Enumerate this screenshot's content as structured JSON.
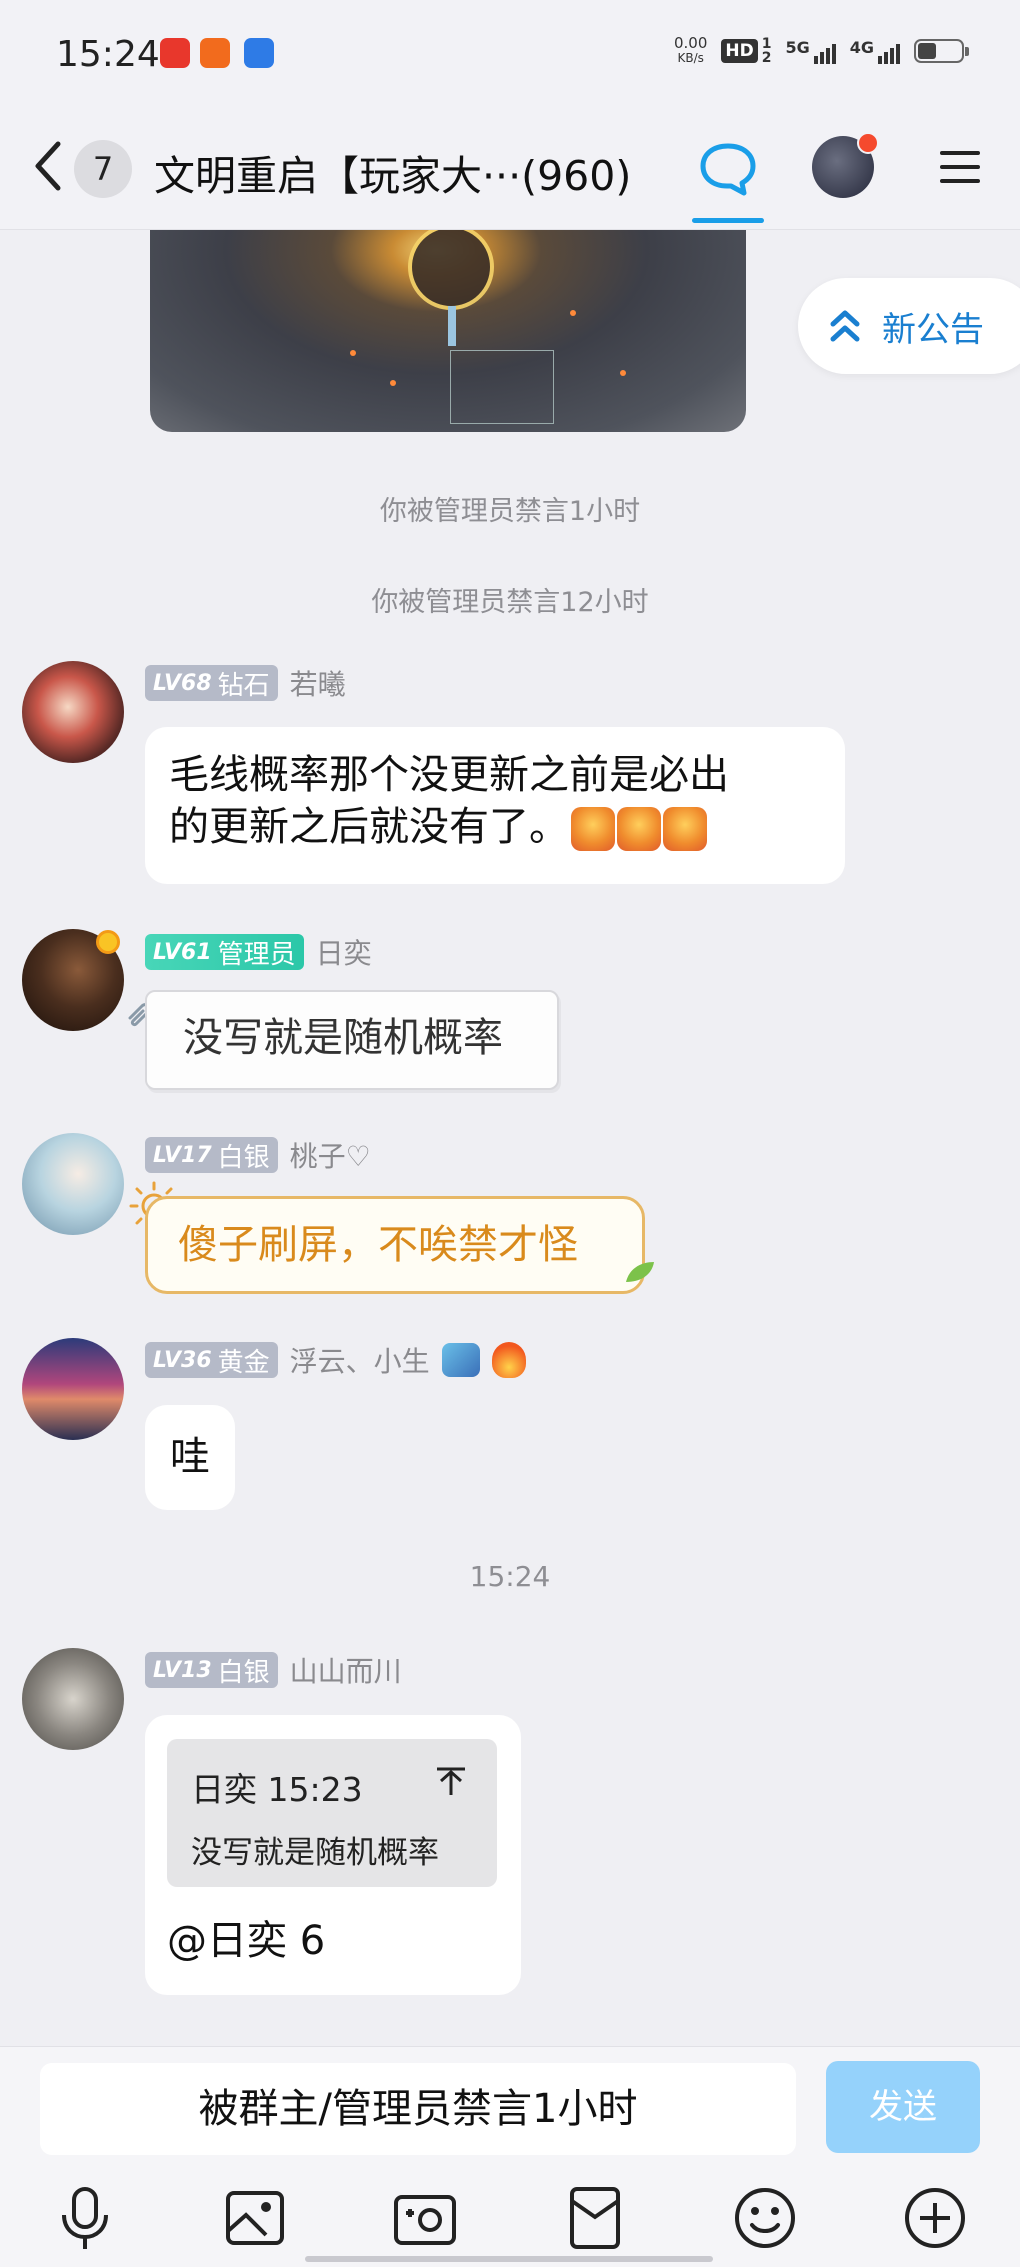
{
  "status_bar": {
    "time": "15:24",
    "net_speed_value": "0.00",
    "net_speed_unit": "KB/s",
    "hd": "HD",
    "sim1": "1",
    "sim2": "2",
    "signal1_label": "5G",
    "signal2_label": "4G"
  },
  "header": {
    "unread_count": "7",
    "title": "文明重启【玩家大···(960)"
  },
  "announcement": {
    "label": "新公告"
  },
  "system_messages": [
    "你被管理员禁言1小时",
    "你被管理员禁言12小时"
  ],
  "timestamp": "15:24",
  "messages": [
    {
      "level": "LV68",
      "rank": "钻石",
      "nickname": "若曦",
      "text_line1": "毛线概率那个没更新之前是必出",
      "text_line2": "的更新之后就没有了。"
    },
    {
      "level": "LV61",
      "rank": "管理员",
      "nickname": "日奕",
      "text": "没写就是随机概率"
    },
    {
      "level": "LV17",
      "rank": "白银",
      "nickname": "桃子♡",
      "text": "傻子刷屏，不唉禁才怪"
    },
    {
      "level": "LV36",
      "rank": "黄金",
      "nickname": "浮云、小生",
      "text": "哇"
    },
    {
      "level": "LV13",
      "rank": "白银",
      "nickname": "山山而川",
      "quote_author": "日奕 15:23",
      "quote_text": "没写就是随机概率",
      "text": "@日奕 6"
    }
  ],
  "input": {
    "value": "被群主/管理员禁言1小时",
    "send_label": "发送"
  },
  "colors": {
    "accent": "#1a9ee8",
    "send_disabled": "#95d2fb",
    "badge_grey": "#b5bac8",
    "badge_admin": "#2bc7a8",
    "sticker_text": "#d98a1c"
  }
}
